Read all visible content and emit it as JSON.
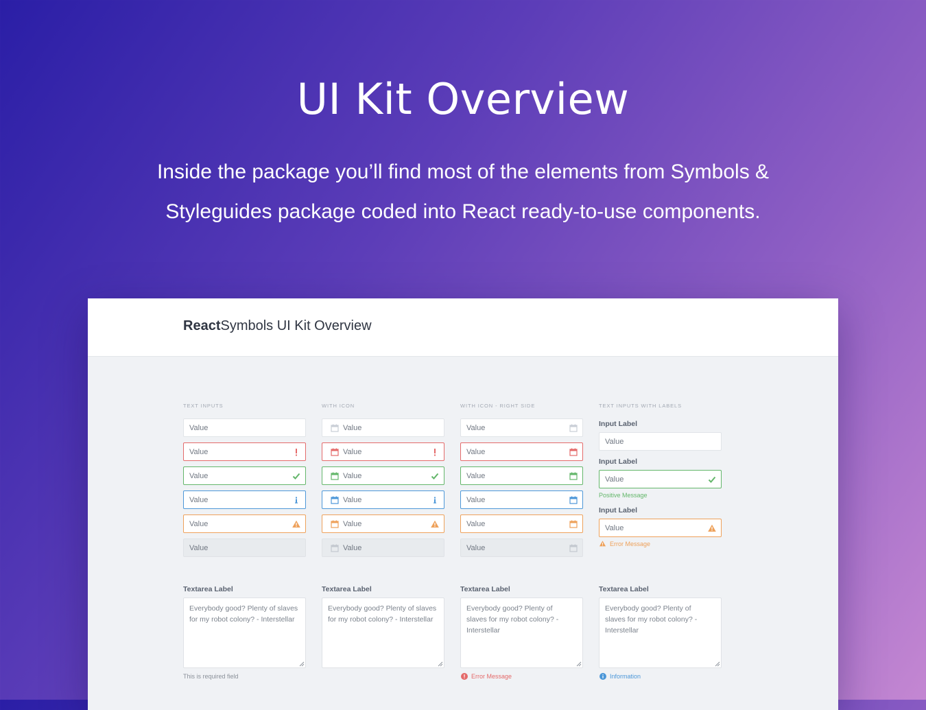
{
  "hero": {
    "title": "UI Kit Overview",
    "subtitle": "Inside the package you’ll find most of the elements from Symbols & Styleguides package coded into React ready-to-use components."
  },
  "panel": {
    "brand_bold": "React",
    "brand_rest": "Symbols UI Kit Overview"
  },
  "sections": {
    "text_inputs": "TEXT INPUTS",
    "with_icon": "WITH ICON",
    "with_icon_right": "WITH ICON - RIGHT SIDE",
    "with_labels": "TEXT INPUTS WITH LABELS"
  },
  "input_value": "Value",
  "labeled": {
    "label": "Input Label",
    "positive_message": "Positive Message",
    "error_message": "Error Message"
  },
  "textareas": {
    "label": "Textarea Label",
    "text": "Everybody good? Plenty of slaves for my robot colony? - Interstellar",
    "required_hint": "This is required field",
    "error_message": "Error Message",
    "information": "Information"
  },
  "colors": {
    "error": "#e46a6a",
    "success": "#63b66a",
    "info": "#4c97d8",
    "warning": "#eea15a",
    "neutral_icon": "#c9ced6"
  },
  "icons": [
    "calendar-icon",
    "exclamation-icon",
    "check-icon",
    "info-icon",
    "warning-icon",
    "error-circle-icon",
    "info-circle-icon"
  ]
}
